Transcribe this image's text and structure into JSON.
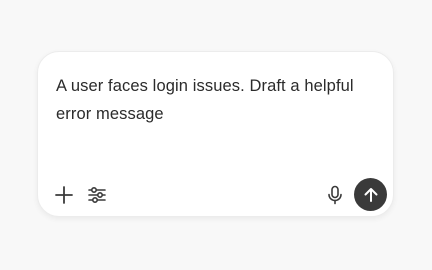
{
  "composer": {
    "prompt_text": "A user faces login issues. Draft a helpful error message",
    "icons": {
      "add": "plus-icon",
      "tools": "sliders-icon",
      "voice": "microphone-icon",
      "send": "arrow-up-icon"
    },
    "colors": {
      "send_button_bg": "#3a3a3a",
      "text": "#2b2b2b",
      "icon": "#3a3a3a"
    }
  }
}
